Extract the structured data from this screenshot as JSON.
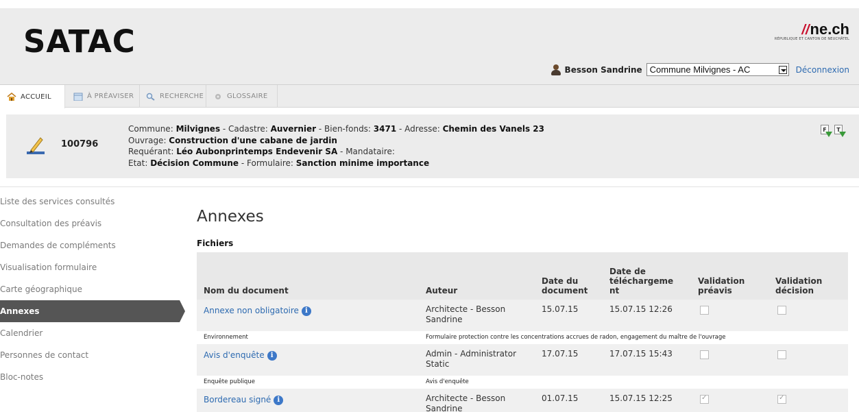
{
  "header": {
    "logo": "SATAC",
    "brand": {
      "bars": "//",
      "name": "ne.ch",
      "sub": "RÉPUBLIQUE ET CANTON DE NEUCHÂTEL"
    },
    "user": "Besson Sandrine",
    "commune_selected": "Commune Milvignes - AC",
    "logout_label": "Déconnexion"
  },
  "tabs": [
    {
      "label": "ACCUEIL",
      "icon": "home-icon",
      "active": true
    },
    {
      "label": "À PRÉAVISER",
      "icon": "calendar-icon",
      "active": false
    },
    {
      "label": "RECHERCHE",
      "icon": "search-icon",
      "active": false
    },
    {
      "label": "GLOSSAIRE",
      "icon": "gear-icon",
      "active": false
    }
  ],
  "dossier": {
    "number": "100796",
    "line1": {
      "commune_label": "Commune: ",
      "commune": "Milvignes",
      "cadastre_label": " - Cadastre: ",
      "cadastre": "Auvernier",
      "bienfonds_label": " - Bien-fonds: ",
      "bienfonds": "3471",
      "adresse_label": " - Adresse: ",
      "adresse": "Chemin des Vanels 23"
    },
    "line2": {
      "ouvrage_label": "Ouvrage: ",
      "ouvrage": "Construction d'une cabane de jardin"
    },
    "line3": {
      "requerant_label": "Requérant: ",
      "requerant": "Léo Aubonprintemps Endevenir SA",
      "mandataire_label": " - Mandataire:"
    },
    "line4": {
      "etat_label": "Etat: ",
      "etat": "Décision Commune",
      "formulaire_label": " - Formulaire: ",
      "formulaire": "Sanction minime importance"
    },
    "actions": [
      "F",
      "T"
    ]
  },
  "sidebar": {
    "items": [
      {
        "label": "Liste des services consultés",
        "active": false
      },
      {
        "label": "Consultation des préavis",
        "active": false
      },
      {
        "label": "Demandes de compléments",
        "active": false
      },
      {
        "label": "Visualisation formulaire",
        "active": false
      },
      {
        "label": "Carte géographique",
        "active": false
      },
      {
        "label": "Annexes",
        "active": true
      },
      {
        "label": "Calendrier",
        "active": false
      },
      {
        "label": "Personnes de contact",
        "active": false
      },
      {
        "label": "Bloc-notes",
        "active": false
      }
    ]
  },
  "main": {
    "title": "Annexes",
    "section": "Fichiers",
    "columns": {
      "nom": "Nom du document",
      "auteur": "Auteur",
      "date_doc": "Date du document",
      "date_tel": "Date de téléchargeme nt",
      "val_preavis": "Validation préavis",
      "val_decision": "Validation décision"
    },
    "rows": [
      {
        "nom": "Annexe non obligatoire",
        "auteur": "Architecte - Besson Sandrine",
        "date_doc": "15.07.15",
        "date_tel": "15.07.15 12:26",
        "val_preavis": false,
        "val_decision": false,
        "categorie": "Environnement",
        "description": "Formulaire protection contre les concentrations accrues de radon, engagement du maître de l'ouvrage"
      },
      {
        "nom": "Avis d'enquête",
        "auteur": "Admin - Administrator Static",
        "date_doc": "17.07.15",
        "date_tel": "17.07.15 15:43",
        "val_preavis": false,
        "val_decision": false,
        "categorie": "Enquête publique",
        "description": "Avis d'enquête"
      },
      {
        "nom": "Bordereau signé",
        "auteur": "Architecte - Besson Sandrine",
        "date_doc": "01.07.15",
        "date_tel": "15.07.15 12:25",
        "val_preavis": true,
        "val_decision": true,
        "categorie": "",
        "description": ""
      }
    ]
  },
  "colors": {
    "link": "#2d6ab0",
    "active_sidebar": "#555555",
    "panel_bg": "#ececec",
    "brand_red": "#c8102e"
  }
}
